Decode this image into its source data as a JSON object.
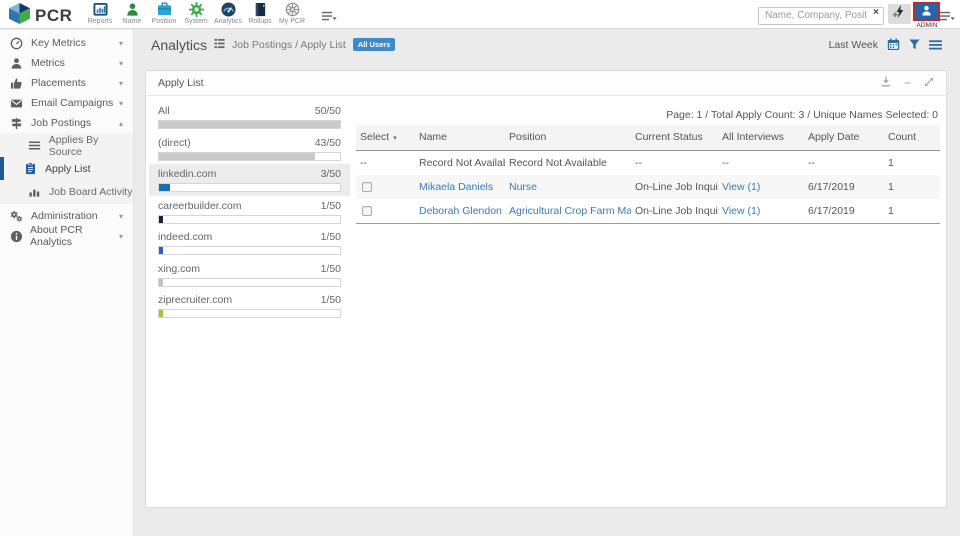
{
  "topbar": {
    "logo_text": "PCR",
    "nav_items": [
      {
        "label": "Reports",
        "icon": "bar-chart-frame-icon"
      },
      {
        "label": "Name",
        "icon": "person-icon"
      },
      {
        "label": "Position",
        "icon": "briefcase-icon"
      },
      {
        "label": "System",
        "icon": "gear-icon"
      },
      {
        "label": "Analytics",
        "icon": "gauge-icon"
      },
      {
        "label": "Rollups",
        "icon": "ledger-icon"
      },
      {
        "label": "My PCR",
        "icon": "wheel-icon"
      }
    ],
    "search": {
      "placeholder": "Name, Company, Position"
    },
    "admin_label": "ADMIN"
  },
  "sidebar": {
    "items": [
      {
        "label": "Key Metrics",
        "icon": "gauge-icon"
      },
      {
        "label": "Metrics",
        "icon": "person-icon"
      },
      {
        "label": "Placements",
        "icon": "thumbs-up-icon"
      },
      {
        "label": "Email Campaigns",
        "icon": "envelope-icon"
      },
      {
        "label": "Job Postings",
        "icon": "signpost-icon"
      }
    ],
    "sub_items": [
      {
        "label": "Applies By Source",
        "icon": "list-icon"
      },
      {
        "label": "Apply List",
        "icon": "clipboard-icon"
      },
      {
        "label": "Job Board Activity",
        "icon": "bar-chart-icon"
      }
    ],
    "footer_items": [
      {
        "label": "Administration",
        "icon": "gears-icon"
      },
      {
        "label": "About PCR Analytics",
        "icon": "info-icon"
      }
    ]
  },
  "breadcrumb": {
    "title": "Analytics",
    "path": "Job Postings / Apply List",
    "badge": "All Users",
    "period": "Last Week"
  },
  "panel": {
    "title": "Apply List"
  },
  "sources": [
    {
      "name": "All",
      "value": "50/50",
      "pct": 100,
      "color": "#c9c9c9",
      "selected": false
    },
    {
      "name": "(direct)",
      "value": "43/50",
      "pct": 86,
      "color": "#c9c9c9",
      "selected": false
    },
    {
      "name": "linkedin.com",
      "value": "3/50",
      "pct": 6,
      "color": "#1471ad",
      "selected": true
    },
    {
      "name": "careerbuilder.com",
      "value": "1/50",
      "pct": 2,
      "color": "#13233a",
      "selected": false
    },
    {
      "name": "indeed.com",
      "value": "1/50",
      "pct": 2,
      "color": "#2d5be3",
      "selected": false
    },
    {
      "name": "xing.com",
      "value": "1/50",
      "pct": 2,
      "color": "#c0c0c0",
      "selected": false
    },
    {
      "name": "ziprecruiter.com",
      "value": "1/50",
      "pct": 2,
      "color": "#9dc73b",
      "selected": false
    }
  ],
  "table": {
    "info": "Page: 1 / Total Apply Count: 3 / Unique Names Selected: 0",
    "columns": [
      "Select",
      "Name",
      "Position",
      "Current Status",
      "All Interviews",
      "Apply Date",
      "Count"
    ],
    "rows": [
      {
        "select": "--",
        "name": "Record Not Available",
        "position": "Record Not Available",
        "status": "--",
        "interviews": "--",
        "date": "--",
        "count": "1"
      },
      {
        "select": "",
        "name": "Mikaela Daniels",
        "position": "Nurse",
        "status": "On-Line Job Inquiry",
        "interviews": "View (1)",
        "date": "6/17/2019",
        "count": "1"
      },
      {
        "select": "",
        "name": "Deborah Glendon",
        "position": "Agricultural Crop Farm Manager",
        "status": "On-Line Job Inquiry",
        "interviews": "View (1)",
        "date": "6/17/2019",
        "count": "1"
      }
    ]
  },
  "glyphs": {
    "chevron_down": "▾",
    "chevron_up": "▴",
    "sort_caret": "▾",
    "minus": "−",
    "clear": "×"
  },
  "colors": {
    "accent_blue": "#1d5a96",
    "link_blue": "#3a7ab8",
    "badge_blue": "#3e8acc",
    "admin_tile_blue": "#2167ad",
    "admin_border_red": "#c1272d",
    "selected_row_gray": "#ececec"
  }
}
